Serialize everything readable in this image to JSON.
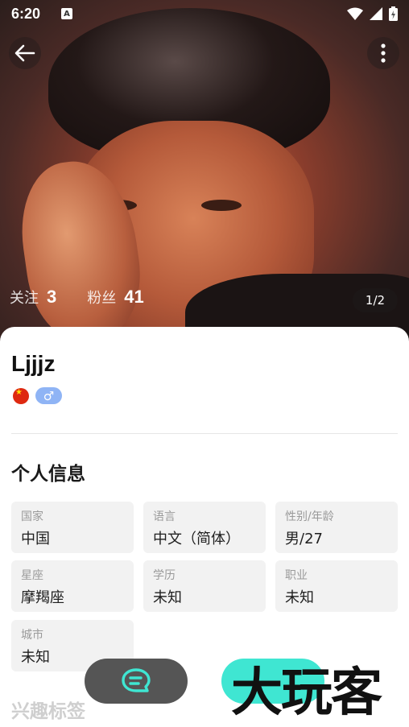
{
  "status_bar": {
    "time": "6:20",
    "notification_glyph": "A",
    "icons": [
      "wifi-icon",
      "signal-icon",
      "battery-charging-icon"
    ]
  },
  "hero": {
    "stats": [
      {
        "label": "关注",
        "value": "3"
      },
      {
        "label": "粉丝",
        "value": "41"
      }
    ],
    "pager": "1/2"
  },
  "profile": {
    "username": "Ljjjz",
    "gender_symbol": "♂",
    "colors": {
      "gender_badge": "#8fb4f5",
      "flag": "#de2910"
    }
  },
  "personal_info": {
    "title": "个人信息",
    "fields": [
      {
        "label": "国家",
        "value": "中国"
      },
      {
        "label": "语言",
        "value": "中文（简体）"
      },
      {
        "label": "性别/年龄",
        "value": "男/27"
      },
      {
        "label": "星座",
        "value": "摩羯座"
      },
      {
        "label": "学历",
        "value": "未知"
      },
      {
        "label": "职业",
        "value": "未知"
      },
      {
        "label": "城市",
        "value": "未知"
      }
    ]
  },
  "interests": {
    "title": "兴趣标签"
  },
  "bottom_bar": {
    "chat_icon": "chat-icon",
    "accent": "#3fe6d2"
  },
  "watermark": "大玩客"
}
